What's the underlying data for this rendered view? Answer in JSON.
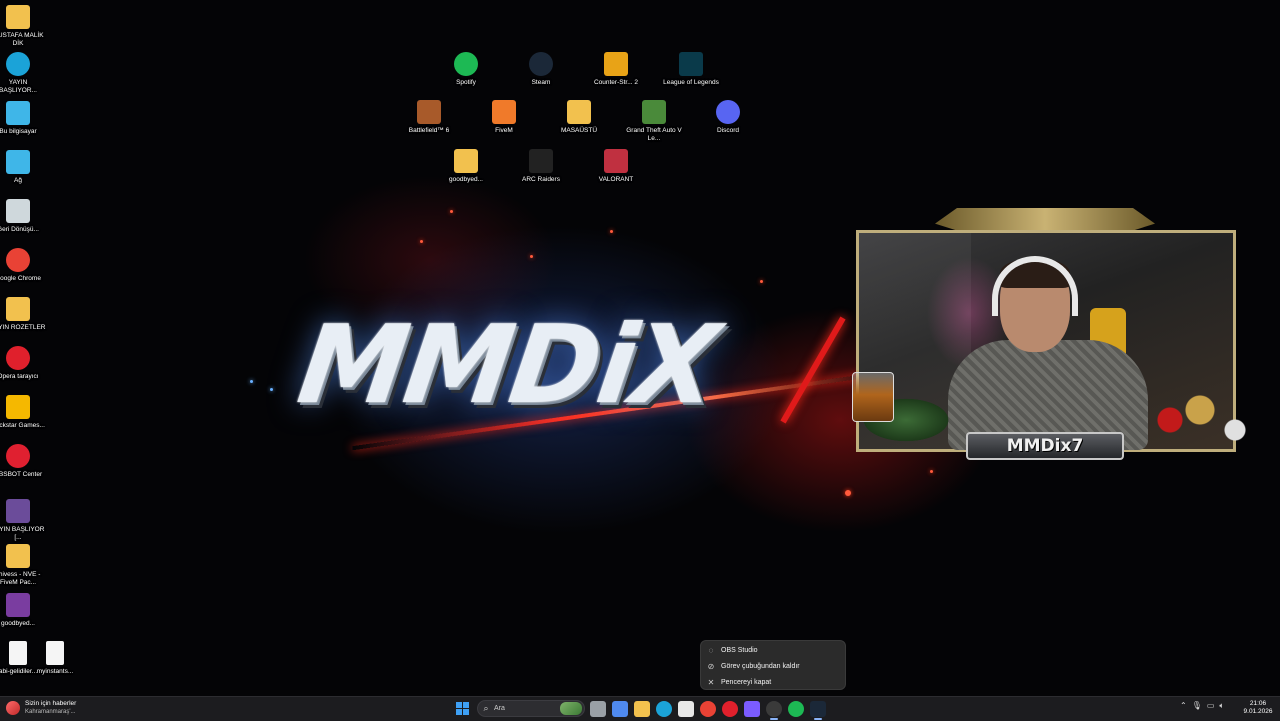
{
  "desktop_left_icons": [
    {
      "label": "MUSTAFA MALİK DİK",
      "icon": "user-folder-icon",
      "color": "#f2c14e"
    },
    {
      "label": "YAYIN BAŞLIYOR...",
      "icon": "edge-icon",
      "color": "#1ba3d8"
    },
    {
      "label": "Bu bilgisayar",
      "icon": "computer-icon",
      "color": "#3fb6e8"
    },
    {
      "label": "Ağ",
      "icon": "network-icon",
      "color": "#3fb6e8"
    },
    {
      "label": "Geri Dönüşü...",
      "icon": "recycle-bin-icon",
      "color": "#cfd8dc"
    },
    {
      "label": "Google Chrome",
      "icon": "chrome-icon",
      "color": "#e94235"
    },
    {
      "label": "YAYIN ROZETLER",
      "icon": "folder-icon",
      "color": "#f2c14e"
    },
    {
      "label": "Opera tarayıcı",
      "icon": "opera-icon",
      "color": "#e0202c"
    },
    {
      "label": "Rockstar Games...",
      "icon": "rockstar-icon",
      "color": "#f5b800"
    },
    {
      "label": "OBSBOT Center",
      "icon": "obsbot-icon",
      "color": "#e02030"
    },
    {
      "label": "YAYIN BAŞLIYOR [...",
      "icon": "video-file-icon",
      "color": "#6b4c9a"
    },
    {
      "label": "shivess - NVE - FiveM Pac...",
      "icon": "folder-icon",
      "color": "#f2c14e"
    },
    {
      "label": "goodbyed...",
      "icon": "winrar-icon",
      "color": "#7a3da0"
    }
  ],
  "desktop_bottom_icons": [
    {
      "label": "abi-gelidiler...",
      "icon": "media-file-icon"
    },
    {
      "label": "myinstants...",
      "icon": "media-file-icon"
    }
  ],
  "desktop_grid_icons": [
    {
      "label": "Spotify",
      "icon": "spotify-icon",
      "color": "#1db954"
    },
    {
      "label": "Steam",
      "icon": "steam-icon",
      "color": "#1b2838"
    },
    {
      "label": "Counter-Str... 2",
      "icon": "counter-strike-icon",
      "color": "#e8a317"
    },
    {
      "label": "League of Legends",
      "icon": "league-icon",
      "color": "#0a3a4a"
    },
    {
      "label": "Battlefield™ 6",
      "icon": "battlefield-icon",
      "color": "#a85a2a"
    },
    {
      "label": "FiveM",
      "icon": "fivem-icon",
      "color": "#f07a2a"
    },
    {
      "label": "MASAÜSTÜ",
      "icon": "folder-icon",
      "color": "#f2c14e"
    },
    {
      "label": "Grand Theft Auto V Le...",
      "icon": "gta-icon",
      "color": "#4a8a3a"
    },
    {
      "label": "Discord",
      "icon": "discord-icon",
      "color": "#5865f2"
    },
    {
      "label": "goodbyed...",
      "icon": "folder-icon",
      "color": "#f2c14e"
    },
    {
      "label": "ARC Raiders",
      "icon": "arc-raiders-icon",
      "color": "#222222"
    },
    {
      "label": "VALORANT",
      "icon": "valorant-icon",
      "color": "#c03040"
    }
  ],
  "wallpaper": {
    "logo_text": "MMDiX"
  },
  "webcam": {
    "nameplate": "MMDix7"
  },
  "context_menu": {
    "items": [
      {
        "label": "OBS Studio",
        "icon": "obs-icon"
      },
      {
        "label": "Görev çubuğundan kaldır",
        "icon": "unpin-icon"
      },
      {
        "label": "Pencereyi kapat",
        "icon": "close-icon"
      }
    ]
  },
  "taskbar": {
    "news_title": "Sizin için haberler",
    "news_subtitle": "Kahramanmaraş'...",
    "search_placeholder": "Ara",
    "apps": [
      {
        "name": "task-view-icon",
        "color": "#9aa0a6"
      },
      {
        "name": "copilot-icon",
        "color": "#4f8af0"
      },
      {
        "name": "file-explorer-icon",
        "color": "#f2c14e"
      },
      {
        "name": "edge-icon",
        "color": "#1ba3d8"
      },
      {
        "name": "store-icon",
        "color": "#e8e8e8"
      },
      {
        "name": "chrome-icon",
        "color": "#e94235"
      },
      {
        "name": "opera-gx-icon",
        "color": "#e0202c"
      },
      {
        "name": "twitch-icon",
        "color": "#7b5cff"
      },
      {
        "name": "obs-icon",
        "color": "#3a3a3a"
      },
      {
        "name": "spotify-icon",
        "color": "#1db954"
      },
      {
        "name": "steam-icon",
        "color": "#1b2838"
      }
    ],
    "time": "21:06",
    "date": "9.01.2026"
  }
}
